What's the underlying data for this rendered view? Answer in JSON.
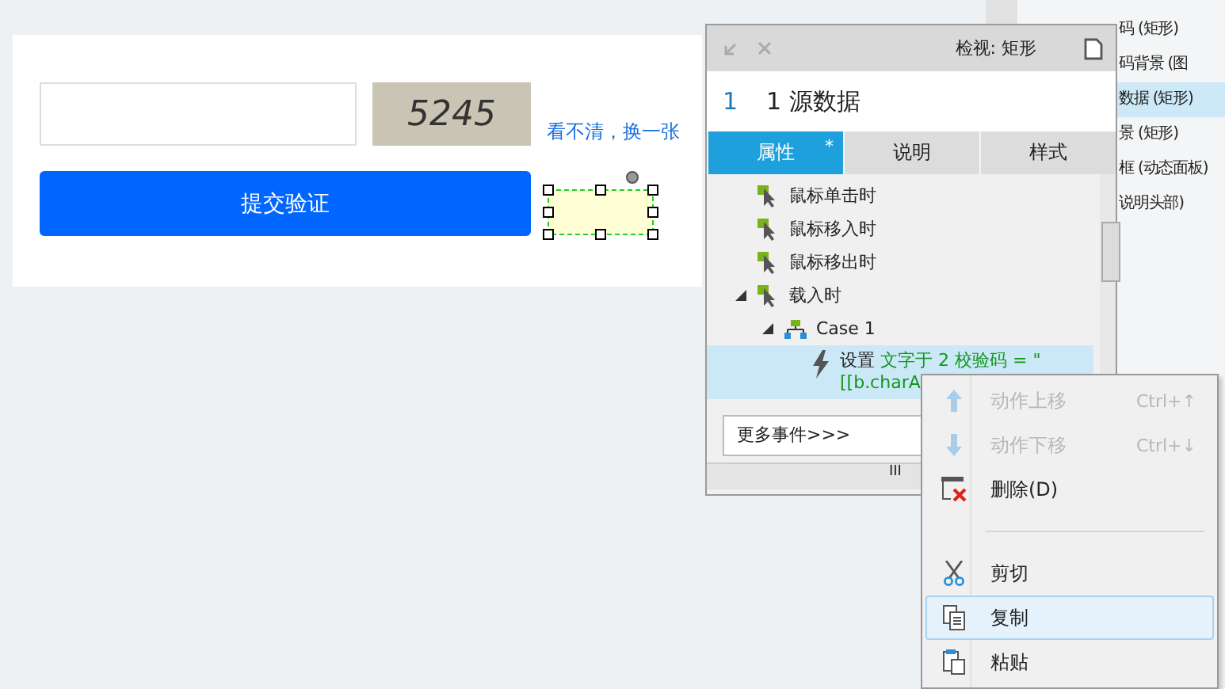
{
  "form": {
    "code_image_text": "5245",
    "refresh_link": "看不清，换一张",
    "submit_button": "提交验证"
  },
  "outline": {
    "items": [
      {
        "label": "码 (矩形)",
        "selected": false
      },
      {
        "label": "码背景 (图",
        "selected": false
      },
      {
        "label": "数据 (矩形)",
        "selected": true
      },
      {
        "label": "景 (矩形)",
        "selected": false
      },
      {
        "label": "框 (动态面板)",
        "selected": false
      },
      {
        "label": "说明头部)",
        "selected": false
      }
    ]
  },
  "inspector": {
    "title": "检视: 矩形",
    "index": "1",
    "name": "1 源数据",
    "tabs": [
      {
        "label": "属性",
        "selected": true,
        "mark": "*"
      },
      {
        "label": "说明",
        "selected": false
      },
      {
        "label": "样式",
        "selected": false
      }
    ],
    "events": [
      {
        "kind": "event",
        "label": "鼠标单击时",
        "selected": false
      },
      {
        "kind": "event",
        "label": "鼠标移入时",
        "selected": false
      },
      {
        "kind": "event",
        "label": "鼠标移出时",
        "selected": false
      },
      {
        "kind": "event",
        "label": "载入时",
        "expanded": true,
        "selected": false,
        "children": [
          {
            "kind": "case",
            "label": "Case 1",
            "expanded": true,
            "selected": false,
            "children": [
              {
                "kind": "action",
                "label": "设置",
                "detail": "文字于 2 校验码 = \"[[b.charA",
                "selected": true
              }
            ]
          }
        ]
      }
    ],
    "more_events": "更多事件>>>",
    "scrollbar_grip": "III"
  },
  "context_menu": {
    "items": [
      {
        "kind": "item",
        "label": "动作上移",
        "shortcut": "Ctrl+↑",
        "disabled": true,
        "selected": false
      },
      {
        "kind": "item",
        "label": "动作下移",
        "shortcut": "Ctrl+↓",
        "disabled": true,
        "selected": false
      },
      {
        "kind": "item",
        "label": "删除(D)",
        "disabled": false,
        "selected": false
      },
      {
        "kind": "separator"
      },
      {
        "kind": "item",
        "label": "剪切",
        "disabled": false,
        "selected": false
      },
      {
        "kind": "item",
        "label": "复制",
        "disabled": false,
        "selected": true
      },
      {
        "kind": "item",
        "label": "粘贴",
        "disabled": false,
        "selected": false
      }
    ]
  }
}
